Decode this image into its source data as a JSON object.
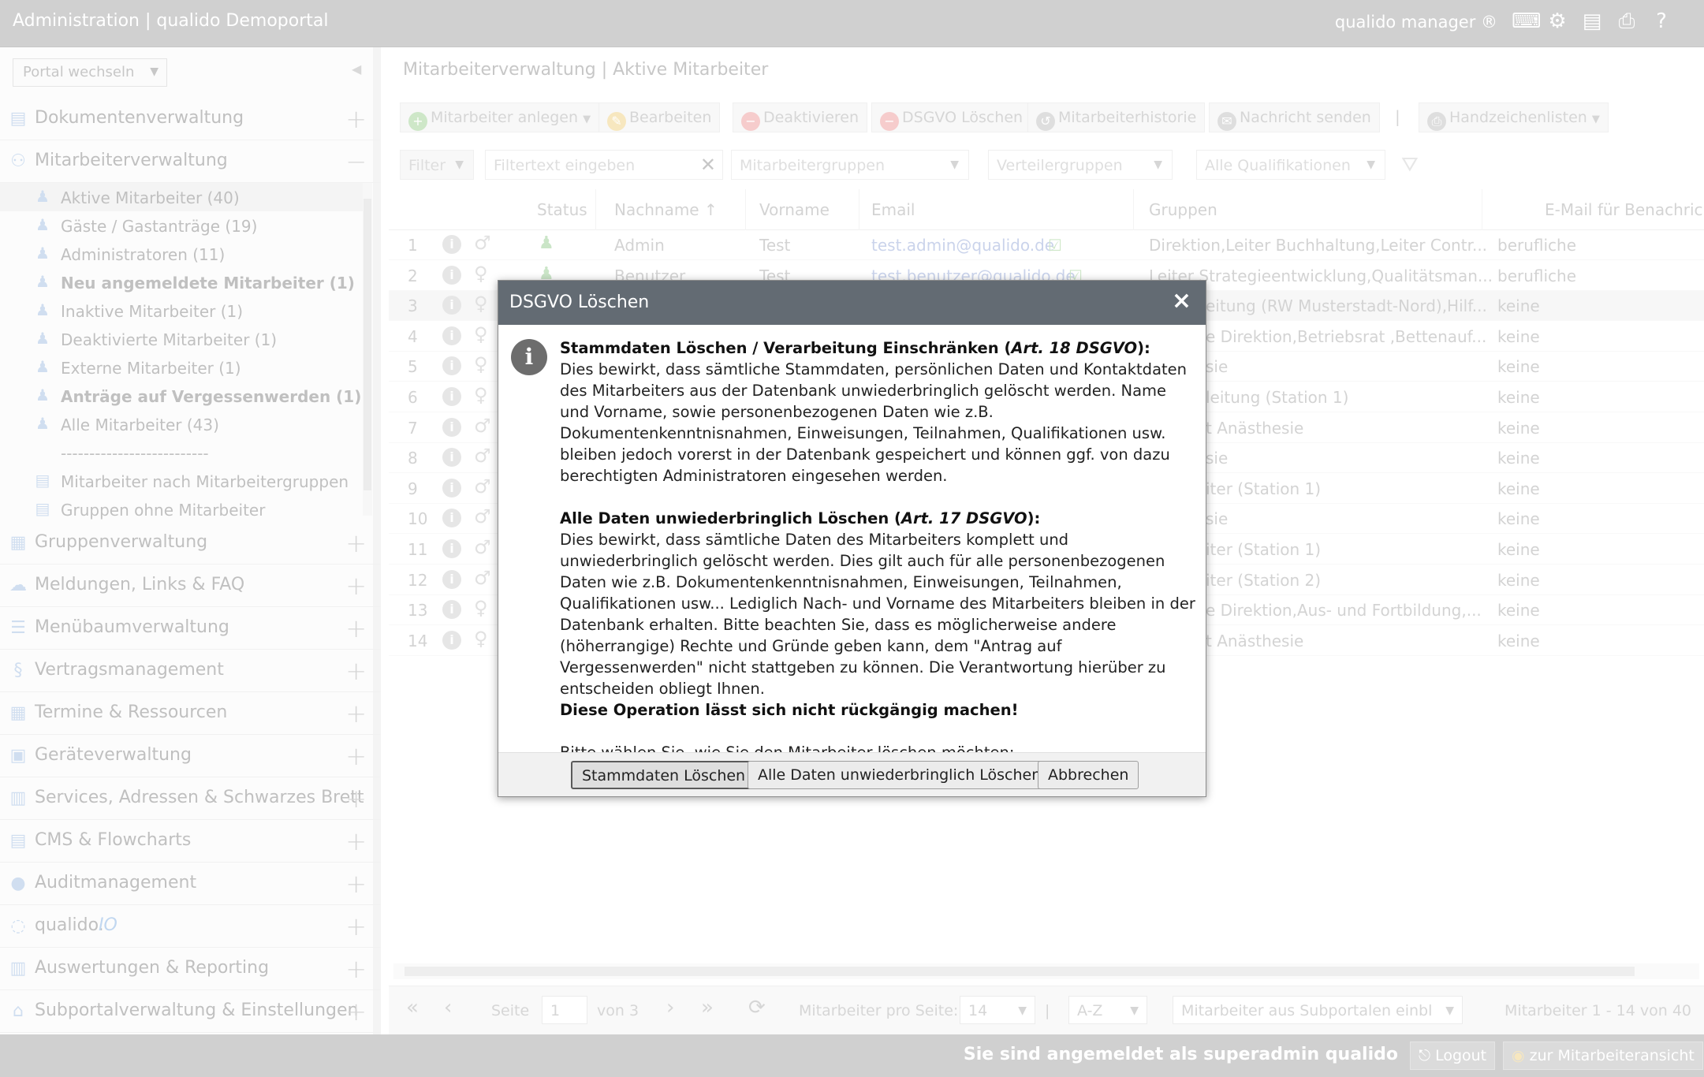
{
  "topbar": {
    "title": "Administration | qualido Demoportal",
    "brand": "qualido manager ®",
    "icons": [
      "keyboard-icon",
      "settings-gears-icon",
      "pdf-icon",
      "printer-icon",
      "help-icon"
    ]
  },
  "sidebar": {
    "portal_select": "Portal wechseln",
    "menu": [
      {
        "label": "Dokumentenverwaltung",
        "icon": "documents-icon",
        "toggle": "+"
      },
      {
        "label": "Mitarbeiterverwaltung",
        "icon": "users-icon",
        "toggle": "−"
      },
      {
        "label": "Gruppenverwaltung",
        "icon": "groups-icon",
        "toggle": "+"
      },
      {
        "label": "Meldungen, Links & FAQ",
        "icon": "chat-icon",
        "toggle": "+"
      },
      {
        "label": "Menübaumverwaltung",
        "icon": "list-icon",
        "toggle": "+"
      },
      {
        "label": "Vertragsmanagement",
        "icon": "paragraph-icon",
        "toggle": "+"
      },
      {
        "label": "Termine & Ressourcen",
        "icon": "calendar-icon",
        "toggle": "+"
      },
      {
        "label": "Geräteverwaltung",
        "icon": "device-icon",
        "toggle": "+"
      },
      {
        "label": "Services, Adressen & Schwarzes Brett",
        "icon": "address-book-icon",
        "toggle": "+"
      },
      {
        "label": "CMS & Flowcharts",
        "icon": "cms-icon",
        "toggle": "+"
      },
      {
        "label": "Auditmanagement",
        "icon": "audit-icon",
        "toggle": "+"
      },
      {
        "label": "qualido.",
        "label_suffix": "IO",
        "icon": "qualido-io-icon",
        "toggle": "+"
      },
      {
        "label": "Auswertungen & Reporting",
        "icon": "bar-chart-icon",
        "toggle": "+"
      },
      {
        "label": "Subportalverwaltung & Einstellungen",
        "icon": "home-icon",
        "toggle": "+"
      }
    ],
    "submenu": [
      {
        "label": "Aktive Mitarbeiter (40)",
        "bold": false,
        "selected": true
      },
      {
        "label": "Gäste / Gastanträge (19)",
        "bold": false
      },
      {
        "label": "Administratoren (11)",
        "bold": false
      },
      {
        "label": "Neu angemeldete Mitarbeiter (1)",
        "bold": true
      },
      {
        "label": "Inaktive Mitarbeiter (1)",
        "bold": false
      },
      {
        "label": "Deaktivierte Mitarbeiter (1)",
        "bold": false
      },
      {
        "label": "Externe Mitarbeiter (1)",
        "bold": false
      },
      {
        "label": "Anträge auf Vergessenwerden (1)",
        "bold": true
      },
      {
        "label": "Alle Mitarbeiter (43)",
        "bold": false
      },
      {
        "label": "--------------------------",
        "bold": false,
        "separator": true
      },
      {
        "label": "Mitarbeiter nach Mitarbeitergruppen",
        "bold": false
      },
      {
        "label": "Gruppen ohne Mitarbeiter",
        "bold": false
      }
    ]
  },
  "main": {
    "breadcrumb": "Mitarbeiterverwaltung | Aktive Mitarbeiter",
    "toolbar": [
      {
        "label": "Mitarbeiter anlegen",
        "icon": "plus-icon",
        "color": "#a6d39b",
        "dropdown": true
      },
      {
        "label": "Bearbeiten",
        "icon": "edit-icon",
        "color": "#f1d48a"
      },
      {
        "label": "Deaktivieren",
        "icon": "minus-icon",
        "color": "#eea3a3"
      },
      {
        "label": "DSGVO Löschen",
        "icon": "minus-icon",
        "color": "#eea3a3"
      },
      {
        "label": "Mitarbeiterhistorie",
        "icon": "history-icon",
        "color": "#c4c4c4"
      },
      {
        "label": "Nachricht senden",
        "icon": "chat-icon",
        "color": "#c4c4c4"
      },
      {
        "label": "Handzeichenlisten",
        "icon": "printer-icon",
        "color": "#c4c4c4",
        "dropdown": true
      }
    ],
    "toolbar_sep": "|",
    "filters": {
      "filter": "Filter",
      "text_placeholder": "Filtertext eingeben",
      "groups": "Mitarbeitergruppen",
      "distribution": "Verteilergruppen",
      "qualifications": "Alle Qualifikationen"
    },
    "columns": [
      "Status",
      "Nachname",
      "Vorname",
      "Email",
      "Gruppen",
      "E-Mail für Benachrichtigung"
    ],
    "rows": [
      {
        "n": "1",
        "gender": "♂",
        "nachname": "Admin",
        "vorname": "Test",
        "email": "test.admin@qualido.de",
        "gruppen": "Direktion,Leiter Buchhaltung,Leiter Contr...",
        "notify": "berufliche"
      },
      {
        "n": "2",
        "gender": "♀",
        "nachname": "Benutzer",
        "vorname": "Test",
        "email": "test.benutzer@qualido.de",
        "gruppen": "Leiter Strategieentwicklung,Qualitätsman...",
        "notify": "berufliche"
      },
      {
        "n": "3",
        "gender": "♀",
        "gruppen": "eitung (RW Musterstadt-Nord),Hilf...",
        "notify": "keine"
      },
      {
        "n": "4",
        "gender": "♀",
        "gruppen": "e Direktion,Betriebsrat ,Bettenauf...",
        "notify": "keine"
      },
      {
        "n": "5",
        "gender": "♀",
        "gruppen": "sie",
        "notify": "keine"
      },
      {
        "n": "6",
        "gender": "♀",
        "gruppen": "leitung (Station 1)",
        "notify": "keine"
      },
      {
        "n": "7",
        "gender": "♂",
        "gruppen": "t Anästhesie",
        "notify": "keine"
      },
      {
        "n": "8",
        "gender": "♂",
        "gruppen": "sie",
        "notify": "keine"
      },
      {
        "n": "9",
        "gender": "♂",
        "gruppen": "iter (Station 1)",
        "notify": "keine"
      },
      {
        "n": "10",
        "gender": "♂",
        "gruppen": "sie",
        "notify": "keine"
      },
      {
        "n": "11",
        "gender": "♂",
        "gruppen": "iter (Station 1)",
        "notify": "keine"
      },
      {
        "n": "12",
        "gender": "♂",
        "gruppen": "iter (Station 2)",
        "notify": "keine"
      },
      {
        "n": "13",
        "gender": "♀",
        "gruppen": "e Direktion,Aus- und Fortbildung,...",
        "notify": "keine"
      },
      {
        "n": "14",
        "gender": "♀",
        "gruppen": "t Anästhesie",
        "notify": "keine"
      }
    ],
    "pager": {
      "first": "«",
      "prev": "‹",
      "page_label": "Seite",
      "page_value": "1",
      "of_label": "von 3",
      "next": "›",
      "last": "»",
      "refresh": "⟳",
      "per_page_label": "Mitarbeiter pro Seite:",
      "per_page_value": "14",
      "sort_value": "A-Z",
      "subportal_value": "Mitarbeiter aus Subportalen einbl",
      "range_text": "Mitarbeiter 1 - 14 von 40"
    }
  },
  "statusbar": {
    "logged_in": "Sie sind angemeldet als superadmin qualido",
    "logout": "Logout",
    "employee_view": "zur Mitarbeiteransicht"
  },
  "dialog": {
    "title": "DSGVO Löschen",
    "close": "×",
    "p1_title": "Stammdaten Löschen / Verarbeitung Einschränken (",
    "p1_art": "Art. 18 DSGVO",
    "p1_close": "):",
    "p1_text": "Dies bewirkt, dass sämtliche Stammdaten, persönlichen Daten und Kontaktdaten des Mitarbeiters aus der Datenbank unwiederbringlich gelöscht werden. Name und Vorname, sowie personenbezogenen Daten wie z.B. Dokumentenkenntnisnahmen, Einweisungen, Teilnahmen, Qualifikationen usw. bleiben jedoch vorerst in der Datenbank gespeichert und können ggf. von dazu berechtigten Administratoren eingesehen werden.",
    "p2_title": "Alle Daten unwiederbringlich Löschen (",
    "p2_art": "Art. 17 DSGVO",
    "p2_close": "):",
    "p2_text": "Dies bewirkt, dass sämtliche Daten des Mitarbeiters komplett und unwiederbringlich gelöscht werden. Dies gilt auch für alle personenbezogenen Daten wie z.B. Dokumentenkenntnisnahmen, Einweisungen, Teilnahmen, Qualifikationen usw... Lediglich Nach- und Vorname des Mitarbeiters bleiben in der Datenbank erhalten. Bitte beachten Sie, dass es möglicherweise andere (höherrangige) Rechte und Gründe geben kann, dem \"Antrag auf Vergessenwerden\" nicht stattgeben zu können. Die Verantwortung hierüber zu entscheiden obliegt Ihnen.",
    "warning": "Diese Operation lässt sich nicht rückgängig machen!",
    "question": "Bitte wählen Sie, wie Sie den Mitarbeiter löschen möchten:",
    "btn_master": "Stammdaten Löschen",
    "btn_all": "Alle Daten unwiederbringlich Löschen",
    "btn_cancel": "Abbrechen"
  }
}
